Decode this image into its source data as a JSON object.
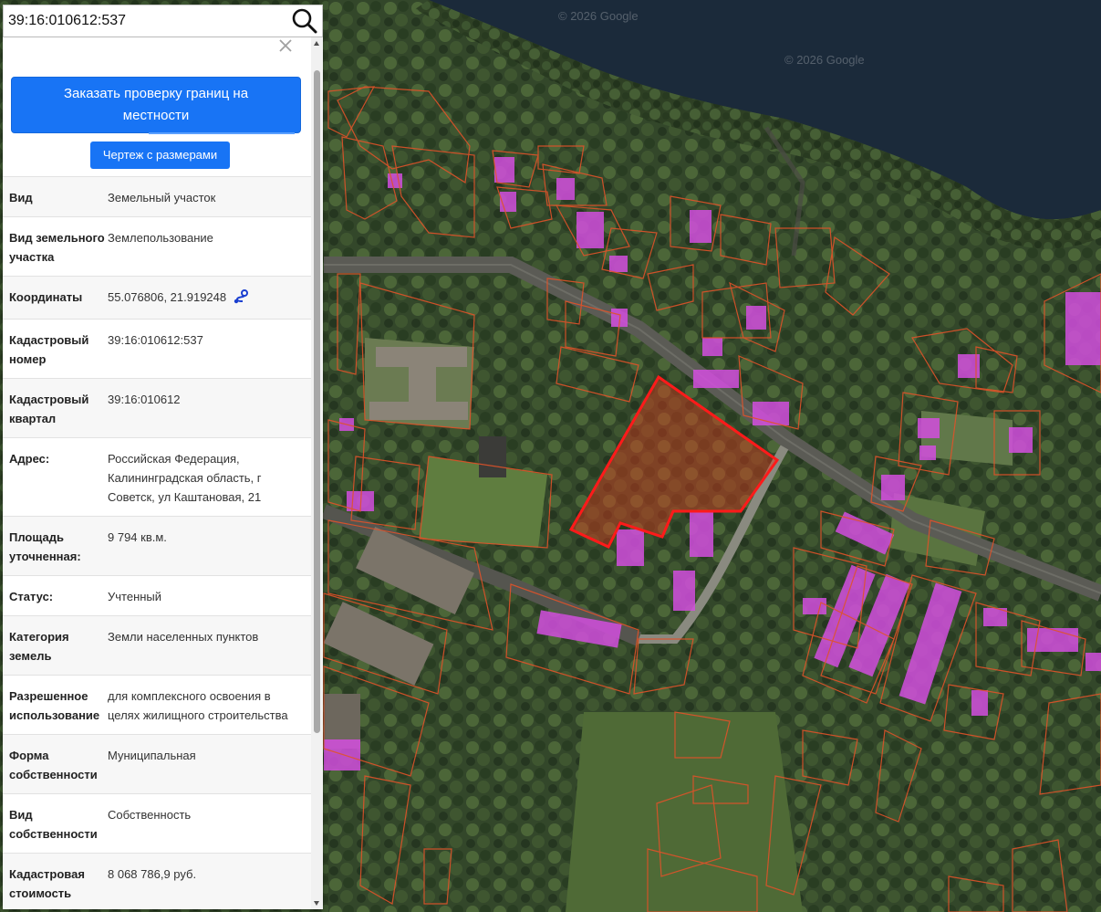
{
  "search": {
    "value": "39:16:010612:537",
    "icon": "search-icon"
  },
  "map": {
    "watermark_1": "© 2026 Google",
    "watermark_2": "© 2026 Google",
    "colors": {
      "water": "#1b2a3a",
      "parcel_border": "#e0532a",
      "selected_border": "#ff1a1a",
      "building_highlight": "#d44fe0"
    }
  },
  "panel": {
    "close_icon": "close-icon",
    "order_button_label": "Заказать проверку границ на местности",
    "drawing_button_label": "Чертеж с размерами",
    "accent_color": "#1874f5",
    "properties": [
      {
        "key": "Вид",
        "value": "Земельный участок"
      },
      {
        "key": "Вид земельного участка",
        "value": "Землепользование"
      },
      {
        "key": "Координаты",
        "value": "55.076806, 21.919248",
        "icon": "route-icon"
      },
      {
        "key": "Кадастровый номер",
        "value": "39:16:010612:537"
      },
      {
        "key": "Кадастровый квартал",
        "value": "39:16:010612"
      },
      {
        "key": "Адрес:",
        "value": "Российская Федерация, Калининградская область, г Советск, ул Каштановая, 21"
      },
      {
        "key": "Площадь уточненная:",
        "value": "9 794 кв.м."
      },
      {
        "key": "Статус:",
        "value": "Учтенный"
      },
      {
        "key": "Категория земель",
        "value": "Земли населенных пунктов"
      },
      {
        "key": "Разрешенное использование",
        "value": "для комплексного освоения в целях жилищного строительства"
      },
      {
        "key": "Форма собственности",
        "value": "Муниципальная"
      },
      {
        "key": "Вид собственности",
        "value": "Собственность"
      },
      {
        "key": "Кадастровая стоимость",
        "value": "8 068 786,9 руб."
      }
    ]
  }
}
